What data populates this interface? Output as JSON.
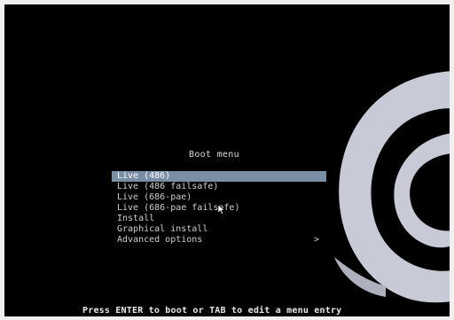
{
  "menu": {
    "title": "Boot menu",
    "items": [
      {
        "label": "Live (486)",
        "selected": true
      },
      {
        "label": "Live (486 failsafe)",
        "selected": false
      },
      {
        "label": "Live (686-pae)",
        "selected": false
      },
      {
        "label": "Live (686-pae failsafe)",
        "selected": false
      },
      {
        "label": "Install",
        "selected": false
      },
      {
        "label": "Graphical install",
        "selected": false
      },
      {
        "label": "Advanced options",
        "selected": false,
        "submenu_indicator": ">"
      }
    ]
  },
  "footer": {
    "hint": "Press ENTER to boot or TAB to edit a menu entry"
  },
  "colors": {
    "background": "#000000",
    "selection": "#7a8fa6",
    "text": "#cfcfcf",
    "swirl": "#c8cad6"
  },
  "icons": {
    "cursor": "mouse-pointer-icon",
    "logo": "debian-swirl-logo"
  }
}
